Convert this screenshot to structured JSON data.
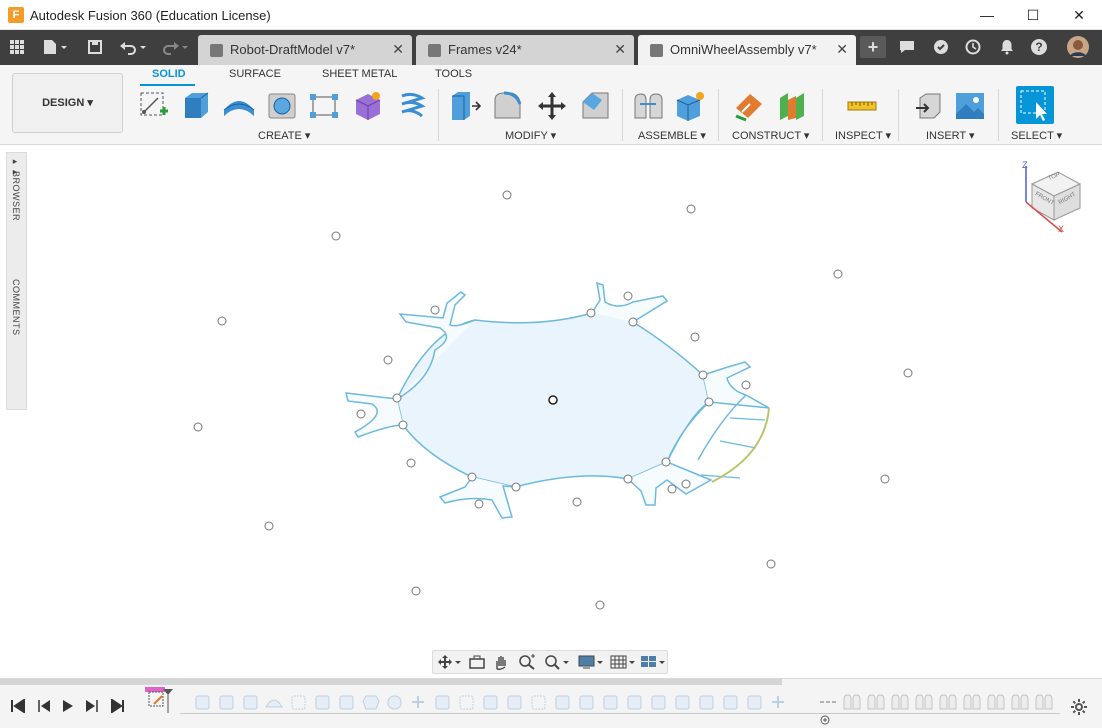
{
  "window": {
    "title": "Autodesk Fusion 360 (Education License)",
    "logo_letter": "F",
    "minimize": "—",
    "maximize": "☐",
    "close": "✕"
  },
  "tabs": [
    {
      "label": "Robot-DraftModel v7*",
      "close": "✕"
    },
    {
      "label": "Frames v24*",
      "close": "✕"
    },
    {
      "label": "OmniWheelAssembly v7*",
      "close": "✕"
    }
  ],
  "tabbar_icons": {
    "apps": "grid-icon",
    "file": "file-icon",
    "save": "save-icon",
    "undo": "undo-icon",
    "redo": "redo-icon",
    "new_tab": "+",
    "comments": "comment-icon",
    "jobs": "job-status-icon",
    "history": "clock-icon",
    "notifications": "bell-icon",
    "help": "?",
    "avatar": "user-avatar"
  },
  "toolbar": {
    "design_label": "DESIGN ▾",
    "workspace_tabs": [
      "SOLID",
      "SURFACE",
      "SHEET METAL",
      "TOOLS"
    ],
    "groups": [
      "CREATE ▾",
      "MODIFY ▾",
      "ASSEMBLE ▾",
      "CONSTRUCT ▾",
      "INSPECT ▾",
      "INSERT ▾",
      "SELECT ▾"
    ],
    "accent_color": "#0696d7"
  },
  "left_panel": {
    "browser_label": "BROWSER",
    "comments_label": "COMMENTS"
  },
  "viewcube": {
    "top": "TOP",
    "front": "FRONT",
    "right": "RIGHT",
    "axis_z": "Z",
    "axis_x": "X"
  },
  "nav_bar": {
    "icons": [
      "orbit-icon",
      "look-at-icon",
      "pan-icon",
      "zoom-window-icon",
      "zoom-icon",
      "display-settings-icon",
      "grid-settings-icon",
      "viewports-icon"
    ]
  },
  "timeline": {
    "controls": [
      "⏮",
      "◀",
      "▶",
      "▶|",
      "⏭"
    ],
    "settings": "gear-icon"
  }
}
